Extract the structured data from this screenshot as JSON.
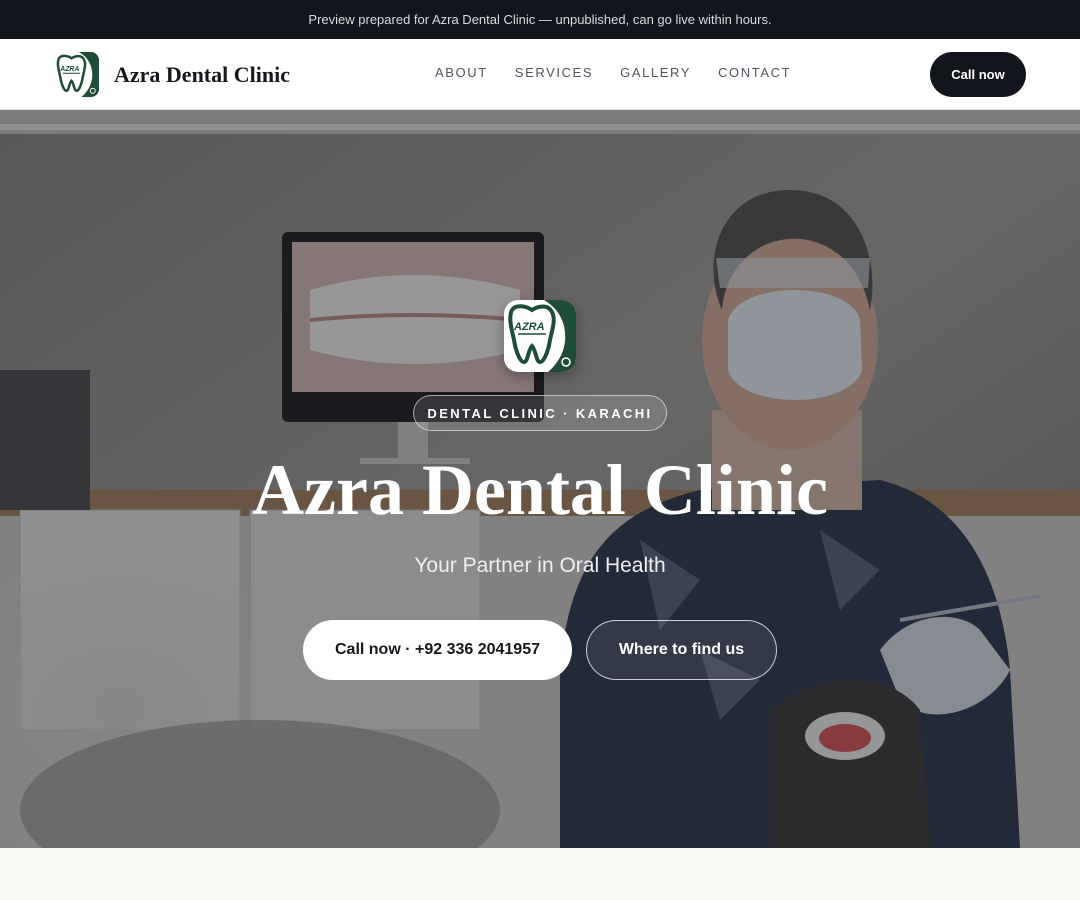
{
  "preview_bar": {
    "text": "Preview prepared for Azra Dental Clinic — unpublished, can go live within hours."
  },
  "header": {
    "brand_name": "Azra Dental Clinic",
    "logo_icon": "tooth-logo-icon",
    "nav": [
      {
        "label": "ABOUT"
      },
      {
        "label": "SERVICES"
      },
      {
        "label": "GALLERY"
      },
      {
        "label": "CONTACT"
      }
    ],
    "cta_label": "Call now"
  },
  "hero": {
    "tagline": "DENTAL CLINIC · KARACHI",
    "title": "Azra Dental Clinic",
    "subtitle": "Your Partner in Oral Health",
    "primary_button": "Call now · +92 336 2041957",
    "secondary_button": "Where to find us",
    "background_image": "dentist-with-patient-photo"
  },
  "colors": {
    "dark": "#12151c",
    "brand_green": "#1d4d36",
    "white": "#ffffff",
    "page_bg": "#faf9f6"
  }
}
